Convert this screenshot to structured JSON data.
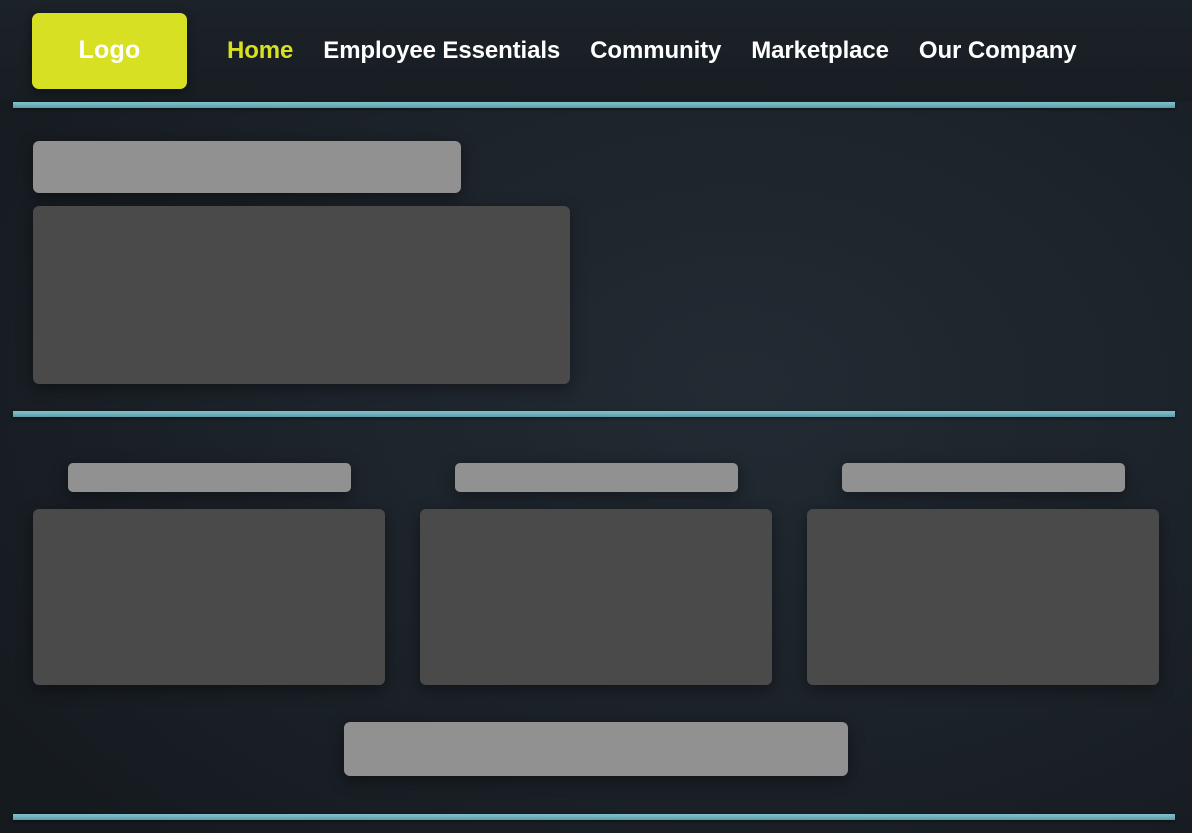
{
  "page": {
    "background_color": "#1d242b",
    "accent_color": "#d7e022",
    "divider_color": "#6fb2bd",
    "placeholder_light_color": "#919191",
    "placeholder_dark_color": "#4a4a4a"
  },
  "navbar": {
    "logo_label": "Logo",
    "links": [
      {
        "label": "Home",
        "active": true
      },
      {
        "label": "Employee Essentials",
        "active": false
      },
      {
        "label": "Community",
        "active": false
      },
      {
        "label": "Marketplace",
        "active": false
      },
      {
        "label": "Our Company",
        "active": false
      }
    ]
  },
  "hero": {
    "heading_placeholder": "",
    "content_placeholder": ""
  },
  "columns": [
    {
      "heading_placeholder": "",
      "content_placeholder": ""
    },
    {
      "heading_placeholder": "",
      "content_placeholder": ""
    },
    {
      "heading_placeholder": "",
      "content_placeholder": ""
    }
  ],
  "footer_cta": {
    "placeholder": ""
  }
}
